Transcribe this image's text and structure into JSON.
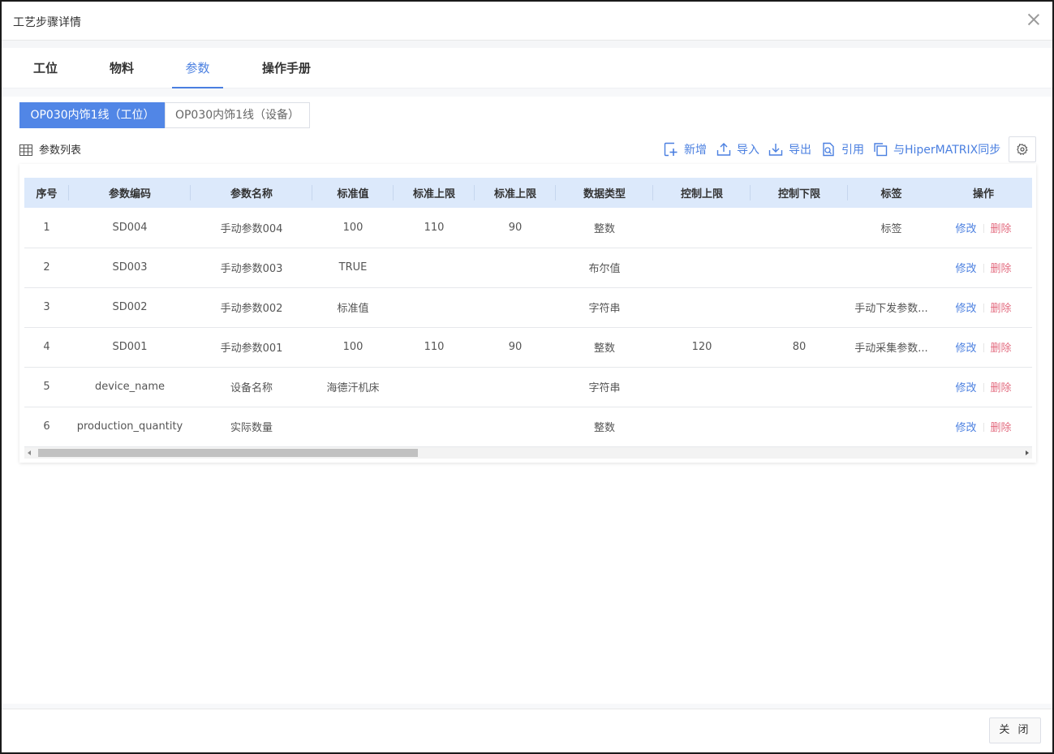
{
  "dialog": {
    "title": "工艺步骤详情",
    "close_label": "关 闭"
  },
  "tabs": [
    {
      "label": "工位",
      "active": false
    },
    {
      "label": "物料",
      "active": false
    },
    {
      "label": "参数",
      "active": true
    },
    {
      "label": "操作手册",
      "active": false
    }
  ],
  "segments": [
    {
      "label": "OP030内饰1线（工位）",
      "active": true
    },
    {
      "label": "OP030内饰1线（设备）",
      "active": false
    }
  ],
  "list": {
    "label": "参数列表"
  },
  "toolbar": {
    "add": "新增",
    "import": "导入",
    "export": "导出",
    "reference": "引用",
    "sync": "与HiperMATRIX同步"
  },
  "table": {
    "columns": [
      "序号",
      "参数编码",
      "参数名称",
      "标准值",
      "标准上限",
      "标准上限",
      "数据类型",
      "控制上限",
      "控制下限",
      "标签",
      "操作"
    ],
    "rows": [
      [
        "1",
        "SD004",
        "手动参数004",
        "100",
        "110",
        "90",
        "整数",
        "",
        "",
        "标签"
      ],
      [
        "2",
        "SD003",
        "手动参数003",
        "TRUE",
        "",
        "",
        "布尔值",
        "",
        "",
        ""
      ],
      [
        "3",
        "SD002",
        "手动参数002",
        "标准值",
        "",
        "",
        "字符串",
        "",
        "",
        "手动下发参数..."
      ],
      [
        "4",
        "SD001",
        "手动参数001",
        "100",
        "110",
        "90",
        "整数",
        "120",
        "80",
        "手动采集参数..."
      ],
      [
        "5",
        "device_name",
        "设备名称",
        "海德汗机床",
        "",
        "",
        "字符串",
        "",
        "",
        ""
      ],
      [
        "6",
        "production_quantity",
        "实际数量",
        "",
        "",
        "",
        "整数",
        "",
        "",
        ""
      ]
    ],
    "action_edit": "修改",
    "action_delete": "删除"
  },
  "colors": {
    "accent": "#4a7fe0",
    "segment_active": "#5186e6",
    "header_bg": "#dce9fb",
    "delete": "#e36b7f"
  }
}
